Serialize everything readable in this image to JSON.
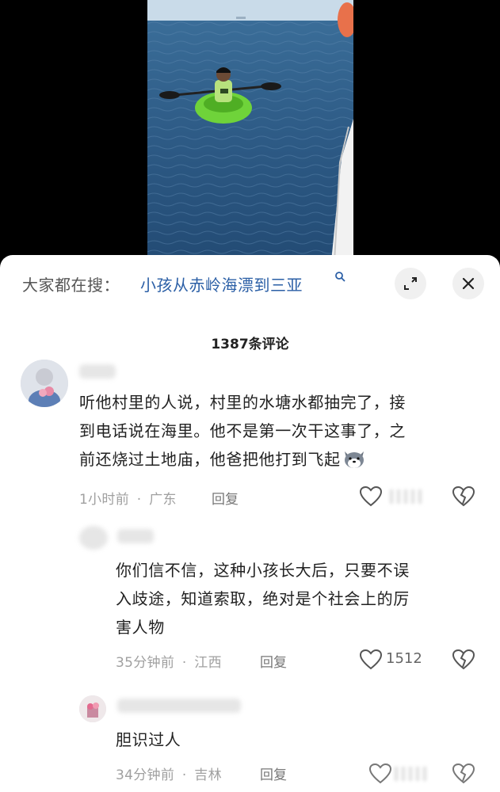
{
  "search_bar": {
    "prefix": "大家都在搜：",
    "query": "小孩从赤岭海漂到三亚"
  },
  "comments_header": {
    "count_label": "1387条评论"
  },
  "comments": [
    {
      "text_lines": [
        "听他村里的人说，村里的水塘水都抽完了，接",
        "到电话说在海里。他不是第一次干这事了，之",
        "前还烧过土地庙，他爸把他打到飞起"
      ],
      "time": "1小时前",
      "separator": "·",
      "location": "广东",
      "reply_label": "回复"
    },
    {
      "text_lines": [
        "你们信不信，这种小孩长大后，只要不误",
        "入歧途，知道索取，绝对是个社会上的厉",
        "害人物"
      ],
      "time": "35分钟前",
      "separator": "·",
      "location": "江西",
      "reply_label": "回复",
      "likes": "1512"
    },
    {
      "text_lines": [
        "胆识过人"
      ],
      "time": "34分钟前",
      "separator": "·",
      "location": "吉林",
      "reply_label": "回复"
    }
  ],
  "icons": {
    "search_hint": "search-icon",
    "expand": "expand-icon",
    "close": "close-icon",
    "like": "heart-icon",
    "dislike": "broken-heart-icon",
    "emoji": "dog-emoji-icon"
  },
  "colors": {
    "search_query": "#2b5fa6",
    "meta_text": "#a0a0a0",
    "sea": "#2d5a85",
    "kayak": "#6fd33a"
  }
}
